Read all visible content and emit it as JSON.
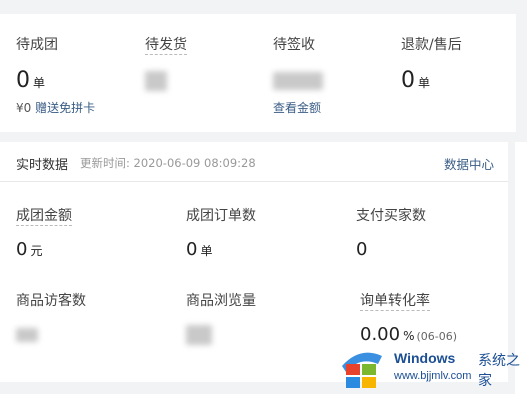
{
  "orders": [
    {
      "label": "待成团",
      "value": "0",
      "unit": "单",
      "link_prefix": "¥0",
      "link": "赠送免拼卡"
    },
    {
      "label": "待发货",
      "value": "",
      "unit": ""
    },
    {
      "label": "待签收",
      "value": "",
      "unit": "",
      "link": "查看金额"
    },
    {
      "label": "退款/售后",
      "value": "0",
      "unit": "单"
    }
  ],
  "realtime": {
    "title": "实时数据",
    "update_prefix": "更新时间:",
    "update_time": "2020-06-09 08:09:28",
    "center_link": "数据中心",
    "metrics": [
      {
        "label": "成团金额",
        "value": "0",
        "unit": "元"
      },
      {
        "label": "成团订单数",
        "value": "0",
        "unit": "单"
      },
      {
        "label": "支付买家数",
        "value": "0",
        "unit": ""
      },
      {
        "label": "商品访客数",
        "value": "",
        "unit": ""
      },
      {
        "label": "商品浏览量",
        "value": "",
        "unit": ""
      },
      {
        "label": "询单转化率",
        "value": "0.00",
        "unit": "%",
        "sub": "(06-06)"
      }
    ]
  },
  "watermark": {
    "brand": "Windows",
    "brand_cn": "系统之家",
    "url": "www.bjjmlv.com",
    "colors": [
      "#e8412c",
      "#7cb82f",
      "#2a8be0",
      "#f7b500"
    ]
  }
}
